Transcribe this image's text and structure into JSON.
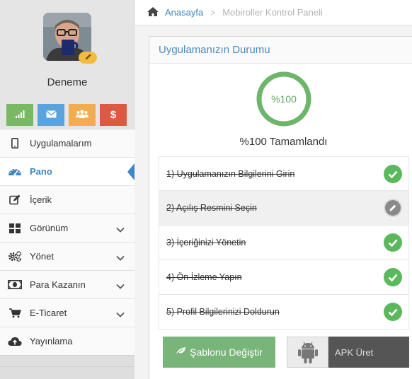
{
  "profile": {
    "name": "Deneme",
    "quick_buttons": [
      {
        "icon": "signal-bars-icon",
        "color": "#79b964"
      },
      {
        "icon": "envelope-icon",
        "color": "#5ba3dc"
      },
      {
        "icon": "users-icon",
        "color": "#f3ad51"
      },
      {
        "icon": "dollar-icon",
        "color": "#dc5944",
        "text": "$"
      }
    ]
  },
  "sidebar": {
    "items": [
      {
        "label": "Uygulamalarım",
        "icon": "mobile-phone-icon"
      },
      {
        "label": "Pano",
        "icon": "dashboard-gauge-icon",
        "active": true
      },
      {
        "label": "İçerik",
        "icon": "edit-icon"
      },
      {
        "label": "Görünüm",
        "icon": "grid-icon",
        "expandable": true
      },
      {
        "label": "Yönet",
        "icon": "gears-icon",
        "expandable": true
      },
      {
        "label": "Para Kazanın",
        "icon": "money-icon",
        "expandable": true
      },
      {
        "label": "E-Ticaret",
        "icon": "cart-icon",
        "expandable": true
      },
      {
        "label": "Yayınlama",
        "icon": "cloud-upload-icon"
      }
    ]
  },
  "breadcrumb": {
    "home": "Anasayfa",
    "current": "Mobiroller Kontrol Paneli"
  },
  "status_panel": {
    "title": "Uygulamanızın Durumu",
    "progress_label": "%100",
    "progress_value": 1.0,
    "caption": "%100 Tamamlandı",
    "steps": [
      {
        "text": "1) Uygulamanızın Bilgilerini Girin",
        "status": "done"
      },
      {
        "text": "2) Açılış Resmini Seçin",
        "status": "edit"
      },
      {
        "text": "3) İçeriğinizi Yönetin",
        "status": "done"
      },
      {
        "text": "4) Ön İzleme Yapın",
        "status": "done"
      },
      {
        "text": "5) Profil Bilgilerinizi Doldurun",
        "status": "done"
      }
    ],
    "template_button": "Şablonu Değiştir",
    "apk_button": "APK Üret"
  },
  "colors": {
    "accent": "#3c85c6",
    "success": "#5cb85c",
    "progress": "#6db56a"
  }
}
